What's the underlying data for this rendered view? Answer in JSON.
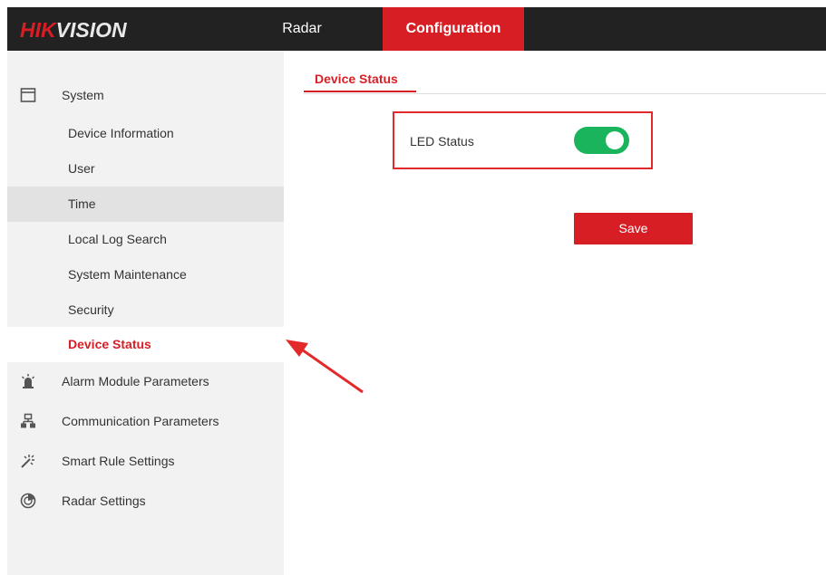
{
  "header": {
    "logo_red": "HIK",
    "logo_rest": "VISION",
    "tabs": [
      {
        "label": "Radar",
        "active": false
      },
      {
        "label": "Configuration",
        "active": true
      }
    ]
  },
  "sidebar": {
    "system": {
      "label": "System",
      "icon": "window-icon",
      "items": [
        {
          "label": "Device Information"
        },
        {
          "label": "User"
        },
        {
          "label": "Time"
        },
        {
          "label": "Local Log Search"
        },
        {
          "label": "System Maintenance"
        },
        {
          "label": "Security"
        },
        {
          "label": "Device Status",
          "active": true
        }
      ]
    },
    "groups": [
      {
        "label": "Alarm Module Parameters",
        "icon": "alarm-light-icon"
      },
      {
        "label": "Communication Parameters",
        "icon": "network-icon"
      },
      {
        "label": "Smart Rule Settings",
        "icon": "smart-rule-icon"
      },
      {
        "label": "Radar Settings",
        "icon": "radar-icon"
      }
    ]
  },
  "content": {
    "tab_label": "Device Status",
    "led_status": {
      "label": "LED Status",
      "value": true
    },
    "save_label": "Save"
  },
  "colors": {
    "accent": "#d81e25",
    "toggle_on": "#19b45b",
    "annotation": "#e32a2a"
  }
}
